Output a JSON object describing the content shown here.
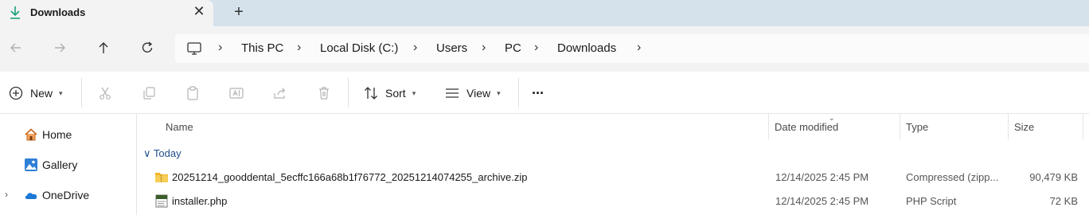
{
  "tab": {
    "title": "Downloads",
    "close": "✕",
    "add": "+"
  },
  "breadcrumb": [
    "This PC",
    "Local Disk (C:)",
    "Users",
    "PC",
    "Downloads"
  ],
  "breadcrumb_sep": "›",
  "commands": {
    "new_label": "New",
    "sort_label": "Sort",
    "view_label": "View",
    "more": "···"
  },
  "sidebar": {
    "items": [
      {
        "label": "Home"
      },
      {
        "label": "Gallery"
      },
      {
        "label": "OneDrive"
      }
    ]
  },
  "columns": {
    "name": "Name",
    "date": "Date modified",
    "type": "Type",
    "size": "Size"
  },
  "group": {
    "label": "Today",
    "chevron": "∨"
  },
  "files": [
    {
      "name": "20251214_gooddental_5ecffc166a68b1f76772_20251214074255_archive.zip",
      "date": "12/14/2025 2:45 PM",
      "type": "Compressed (zipp...",
      "size": "90,479 KB",
      "icon": "zip-folder-icon"
    },
    {
      "name": "installer.php",
      "date": "12/14/2025 2:45 PM",
      "type": "PHP Script",
      "size": "72 KB",
      "icon": "php-file-icon"
    }
  ],
  "colors": {
    "accent": "#1f4e8c",
    "titlebar": "#d5e2ec",
    "chrome": "#f3f3f3"
  }
}
